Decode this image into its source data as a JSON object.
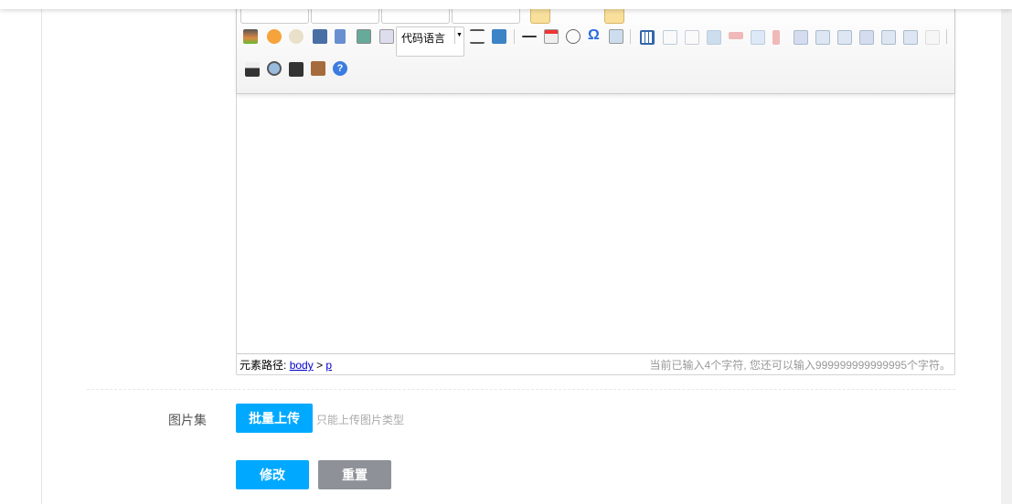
{
  "toolbar": {
    "code_language": "代码语言",
    "colors": {
      "swatch": "#f8df9c",
      "accent": "#00a9ff",
      "reset": "#8e9197"
    }
  },
  "status": {
    "path_label": "元素路径:",
    "path_body": "body",
    "path_sep": ">",
    "path_p": "p",
    "count_text": "当前已输入4个字符, 您还可以输入999999999999995个字符。"
  },
  "gallery": {
    "label": "图片集",
    "upload_button": "批量上传",
    "hint": "只能上传图片类型"
  },
  "actions": {
    "submit": "修改",
    "reset": "重置"
  }
}
